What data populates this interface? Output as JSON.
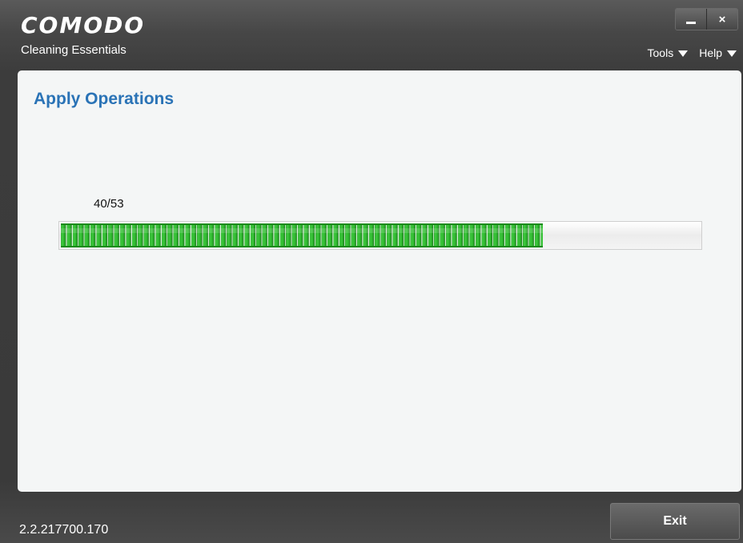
{
  "app": {
    "brand": "COMODO",
    "subtitle": "Cleaning Essentials"
  },
  "window_controls": {
    "minimize_icon": "minimize-icon",
    "close_icon": "close-icon",
    "close_symbol": "×"
  },
  "menus": [
    {
      "label": "Tools",
      "icon": "triangle-down-icon"
    },
    {
      "label": "Help",
      "icon": "triangle-down-icon"
    }
  ],
  "panel": {
    "title": "Apply Operations",
    "progress": {
      "text": "40/53",
      "current": 40,
      "total": 53,
      "fraction": 0.7547
    }
  },
  "footer": {
    "version": "2.2.217700.170",
    "exit_label": "Exit"
  },
  "colors": {
    "title_blue": "#2a73b6",
    "progress_green": "#3fc83f"
  }
}
